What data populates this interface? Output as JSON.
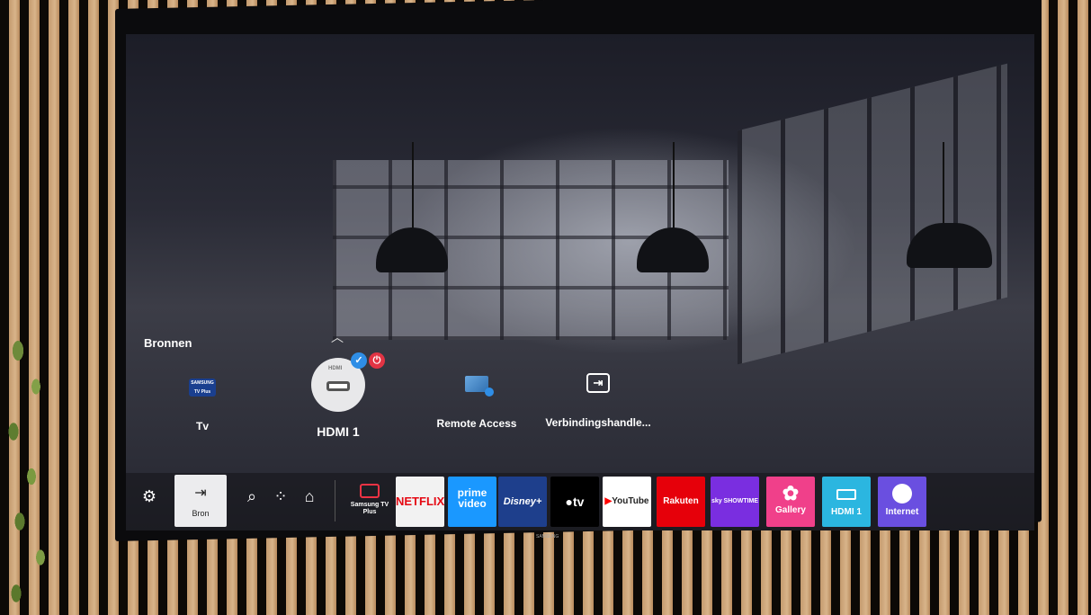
{
  "sources": {
    "title": "Bronnen",
    "items": [
      {
        "label": "Tv",
        "logo_text": "SAMSUNG TV Plus"
      },
      {
        "label": "HDMI 1",
        "icon_label": "HDMI"
      },
      {
        "label": "Remote Access"
      },
      {
        "label": "Verbindingshandle..."
      }
    ]
  },
  "bar": {
    "bron_label": "Bron",
    "apps": [
      {
        "label": "Samsung TV Plus",
        "color": "#1b1b22"
      },
      {
        "label": "NETFLIX",
        "color": "#f2f2f2"
      },
      {
        "label": "prime video",
        "color": "#1a98ff"
      },
      {
        "label": "Disney+",
        "color": "#1e3f8c"
      },
      {
        "label": "tv",
        "color": "#000000"
      },
      {
        "label": "YouTube",
        "color": "#ffffff"
      },
      {
        "label": "Rakuten TV",
        "color": "#e6000a"
      },
      {
        "label": "sky SHOWTIME",
        "color": "#7a2ee0"
      },
      {
        "label": "Gallery",
        "color": "#f0408a"
      },
      {
        "label": "HDMI 1",
        "icon_label": "HDMI 1",
        "color": "#2bb6e0"
      },
      {
        "label": "Internet",
        "color": "#6a4fe0"
      }
    ]
  },
  "tv_brand": "SAMSUNG"
}
